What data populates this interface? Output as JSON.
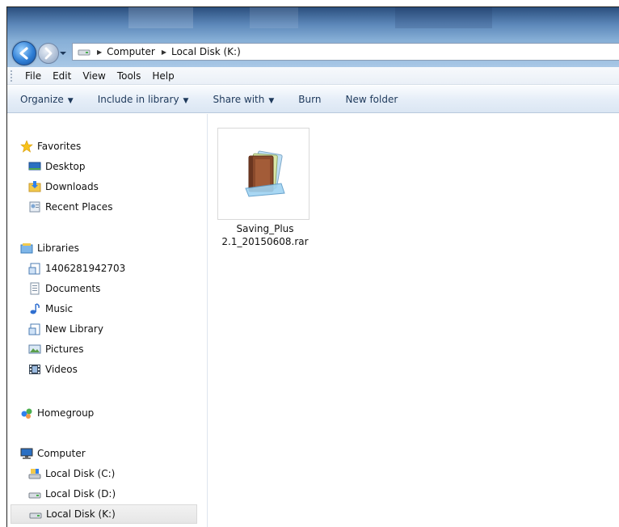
{
  "address": {
    "segments": [
      "Computer",
      "Local Disk (K:)"
    ]
  },
  "menu": [
    "File",
    "Edit",
    "View",
    "Tools",
    "Help"
  ],
  "commands": [
    {
      "label": "Organize",
      "dropdown": true
    },
    {
      "label": "Include in library",
      "dropdown": true
    },
    {
      "label": "Share with",
      "dropdown": true
    },
    {
      "label": "Burn",
      "dropdown": false
    },
    {
      "label": "New folder",
      "dropdown": false
    }
  ],
  "nav": {
    "favorites": {
      "label": "Favorites",
      "icon": "star-icon",
      "items": [
        {
          "label": "Desktop",
          "icon": "desktop-icon"
        },
        {
          "label": "Downloads",
          "icon": "downloads-icon"
        },
        {
          "label": "Recent Places",
          "icon": "recent-places-icon"
        }
      ]
    },
    "libraries": {
      "label": "Libraries",
      "icon": "libraries-icon",
      "items": [
        {
          "label": "1406281942703",
          "icon": "library-icon"
        },
        {
          "label": "Documents",
          "icon": "documents-icon"
        },
        {
          "label": "Music",
          "icon": "music-icon"
        },
        {
          "label": "New Library",
          "icon": "library-icon"
        },
        {
          "label": "Pictures",
          "icon": "pictures-icon"
        },
        {
          "label": "Videos",
          "icon": "videos-icon"
        }
      ]
    },
    "homegroup": {
      "label": "Homegroup",
      "icon": "homegroup-icon"
    },
    "computer": {
      "label": "Computer",
      "icon": "computer-icon",
      "items": [
        {
          "label": "Local Disk (C:)",
          "icon": "system-drive-icon"
        },
        {
          "label": "Local Disk (D:)",
          "icon": "drive-icon"
        },
        {
          "label": "Local Disk (K:)",
          "icon": "drive-icon",
          "selected": true
        }
      ]
    }
  },
  "files": [
    {
      "name_line1": "Saving_Plus",
      "name_line2": "2.1_20150608.rar",
      "icon": "rar-archive-icon"
    }
  ]
}
